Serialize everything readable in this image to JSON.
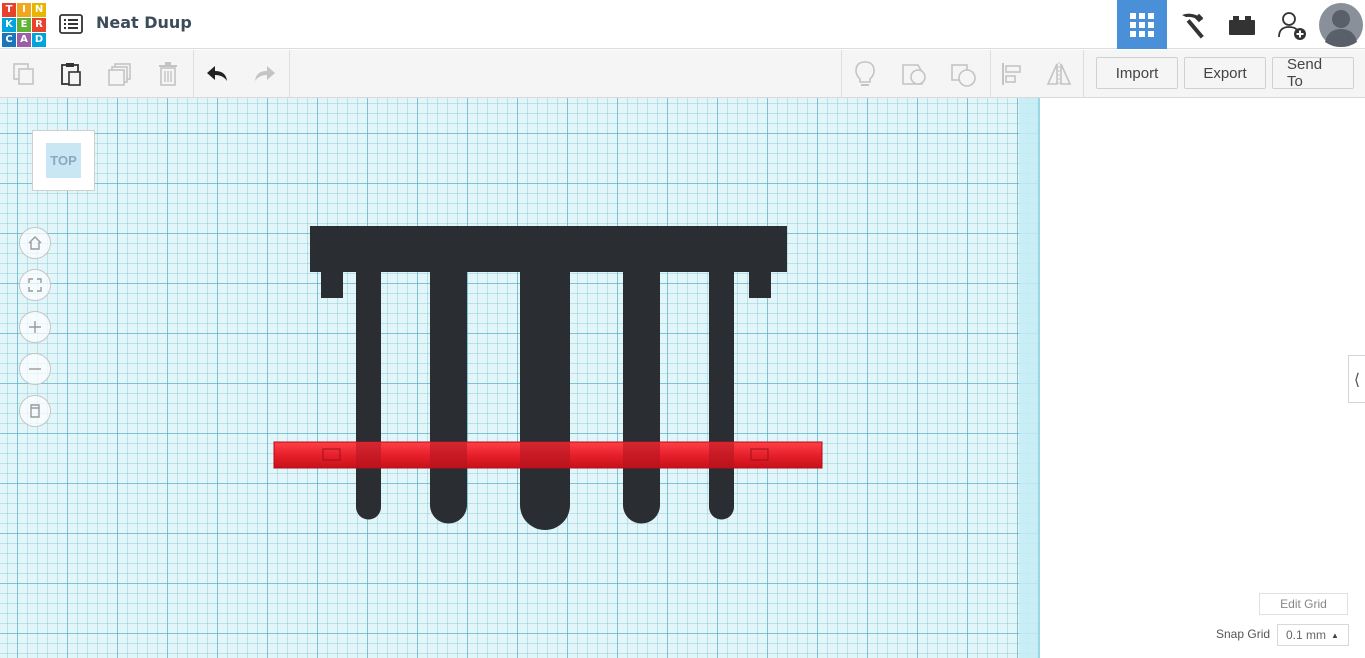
{
  "app": {
    "logo_letters": [
      "T",
      "I",
      "N",
      "K",
      "E",
      "R",
      "C",
      "A",
      "D"
    ],
    "logo_colors": [
      "#e8412c",
      "#f2a61c",
      "#fcd600",
      "#00a3dc",
      "#5fb336",
      "#e8412c",
      "#1b75bb",
      "#9a5fa5",
      "#00a3dc"
    ],
    "design_title": "Neat Duup",
    "accent_color": "#4a90d9"
  },
  "header": {
    "buttons": [
      {
        "name": "3d-design-view",
        "icon": "grid-icon",
        "active": true
      },
      {
        "name": "codeblocks-view",
        "icon": "pickaxe-icon",
        "active": false
      },
      {
        "name": "bricks-view",
        "icon": "brick-icon",
        "active": false
      },
      {
        "name": "invite-user",
        "icon": "add-user-icon",
        "active": false
      },
      {
        "name": "profile",
        "icon": "avatar-icon",
        "active": false
      }
    ]
  },
  "toolbar": {
    "import_label": "Import",
    "export_label": "Export",
    "send_to_label": "Send To"
  },
  "workplane": {
    "view_label": "TOP",
    "shape_colors": {
      "dark": "#2a2e33",
      "red": "#e6202b"
    }
  },
  "panel": {
    "edit_grid_label": "Edit Grid",
    "snap_grid_label": "Snap Grid",
    "snap_grid_value": "0.1 mm"
  }
}
